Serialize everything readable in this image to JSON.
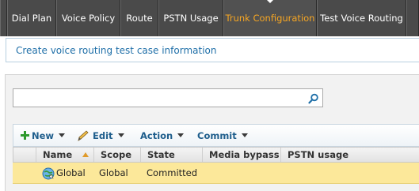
{
  "tabs": [
    {
      "label": "Dial Plan",
      "active": false
    },
    {
      "label": "Voice Policy",
      "active": false
    },
    {
      "label": "Route",
      "active": false
    },
    {
      "label": "PSTN Usage",
      "active": false
    },
    {
      "label": "Trunk Configuration",
      "active": true
    },
    {
      "label": "Test Voice Routing",
      "active": false
    }
  ],
  "description": "Create voice routing test case information",
  "search": {
    "value": "",
    "icon": "search-icon"
  },
  "toolbar": {
    "new_label": "New",
    "edit_label": "Edit",
    "action_label": "Action",
    "commit_label": "Commit"
  },
  "grid": {
    "columns": [
      "Name",
      "Scope",
      "State",
      "Media bypass",
      "PSTN usage"
    ],
    "sorted_column": "Name",
    "rows": [
      {
        "name": "Global",
        "scope": "Global",
        "state": "Committed",
        "media_bypass": "",
        "pstn_usage": "",
        "selected": true
      }
    ]
  },
  "colors": {
    "tab_bg": "#4a4a4a",
    "tab_active_text": "#f6a623",
    "link_blue": "#1f6fa8",
    "row_selected": "#fce89a"
  }
}
